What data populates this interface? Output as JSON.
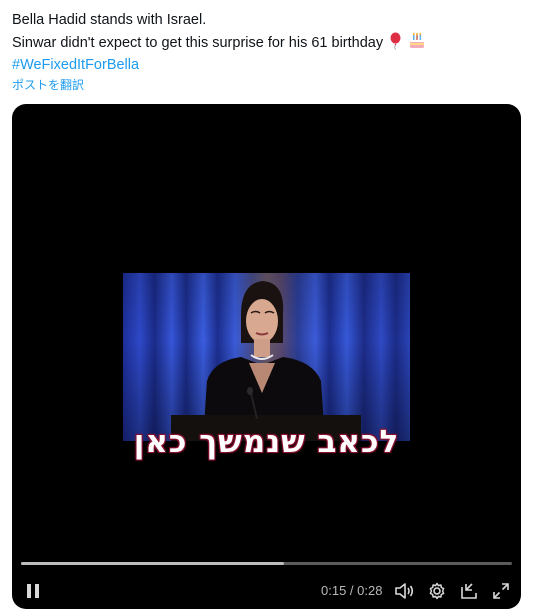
{
  "tweet": {
    "line1": "Bella Hadid stands with Israel.",
    "line2": "Sinwar didn't expect to get this surprise for his 61 birthday",
    "emojis": [
      "balloon-emoji",
      "birthday-cake-emoji"
    ],
    "hashtag": "#WeFixedItForBella",
    "translate_label": "ポストを翻訳"
  },
  "video": {
    "subtitle": "לכאב שנמשך כאן",
    "current_time": "0:15",
    "separator": " / ",
    "duration": "0:28",
    "progress_fraction": 0.536,
    "state": "playing"
  },
  "controls": {
    "icons": [
      "pause-icon",
      "volume-icon",
      "settings-icon",
      "dock-icon",
      "fullscreen-icon"
    ]
  },
  "colors": {
    "accent": "#1d9bf0",
    "player_bg": "#000000",
    "progress_fill": "#bdbdbd",
    "progress_track": "#5b5b5b",
    "subtitle_outline": "#8a1030"
  }
}
